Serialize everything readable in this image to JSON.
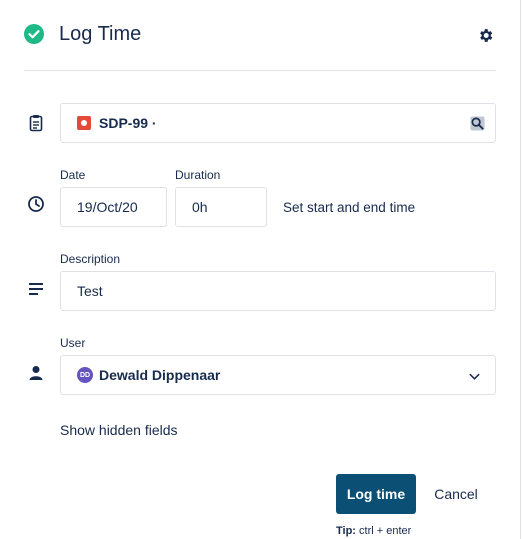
{
  "header": {
    "title": "Log Time",
    "check_icon": "check-circle-icon",
    "settings_icon": "gear-icon",
    "accent": "#1fb987"
  },
  "issue": {
    "key": "SDP-99 ·",
    "icon": "bug-icon",
    "search_icon": "search-icon"
  },
  "date": {
    "label": "Date",
    "value": "19/Oct/20"
  },
  "duration": {
    "label": "Duration",
    "value": "0h"
  },
  "set_start_end": "Set start and end time",
  "description": {
    "label": "Description",
    "value": "Test"
  },
  "user": {
    "label": "User",
    "initials": "DD",
    "name": "Dewald Dippenaar"
  },
  "show_hidden": "Show hidden fields",
  "actions": {
    "log_label": "Log time",
    "cancel_label": "Cancel",
    "primary_color": "#0b4f75"
  },
  "tip": {
    "label": "Tip:",
    "text": " ctrl + enter"
  }
}
